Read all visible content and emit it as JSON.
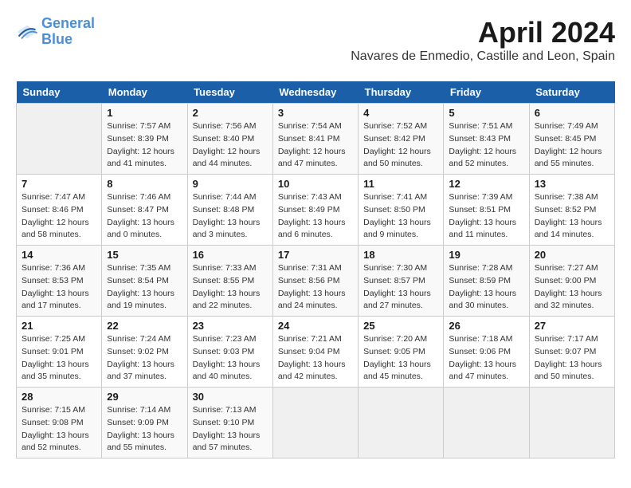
{
  "header": {
    "logo_line1": "General",
    "logo_line2": "Blue",
    "title": "April 2024",
    "subtitle": "Navares de Enmedio, Castille and Leon, Spain"
  },
  "calendar": {
    "days_of_week": [
      "Sunday",
      "Monday",
      "Tuesday",
      "Wednesday",
      "Thursday",
      "Friday",
      "Saturday"
    ],
    "weeks": [
      [
        {
          "day": "",
          "info": ""
        },
        {
          "day": "1",
          "info": "Sunrise: 7:57 AM\nSunset: 8:39 PM\nDaylight: 12 hours\nand 41 minutes."
        },
        {
          "day": "2",
          "info": "Sunrise: 7:56 AM\nSunset: 8:40 PM\nDaylight: 12 hours\nand 44 minutes."
        },
        {
          "day": "3",
          "info": "Sunrise: 7:54 AM\nSunset: 8:41 PM\nDaylight: 12 hours\nand 47 minutes."
        },
        {
          "day": "4",
          "info": "Sunrise: 7:52 AM\nSunset: 8:42 PM\nDaylight: 12 hours\nand 50 minutes."
        },
        {
          "day": "5",
          "info": "Sunrise: 7:51 AM\nSunset: 8:43 PM\nDaylight: 12 hours\nand 52 minutes."
        },
        {
          "day": "6",
          "info": "Sunrise: 7:49 AM\nSunset: 8:45 PM\nDaylight: 12 hours\nand 55 minutes."
        }
      ],
      [
        {
          "day": "7",
          "info": "Sunrise: 7:47 AM\nSunset: 8:46 PM\nDaylight: 12 hours\nand 58 minutes."
        },
        {
          "day": "8",
          "info": "Sunrise: 7:46 AM\nSunset: 8:47 PM\nDaylight: 13 hours\nand 0 minutes."
        },
        {
          "day": "9",
          "info": "Sunrise: 7:44 AM\nSunset: 8:48 PM\nDaylight: 13 hours\nand 3 minutes."
        },
        {
          "day": "10",
          "info": "Sunrise: 7:43 AM\nSunset: 8:49 PM\nDaylight: 13 hours\nand 6 minutes."
        },
        {
          "day": "11",
          "info": "Sunrise: 7:41 AM\nSunset: 8:50 PM\nDaylight: 13 hours\nand 9 minutes."
        },
        {
          "day": "12",
          "info": "Sunrise: 7:39 AM\nSunset: 8:51 PM\nDaylight: 13 hours\nand 11 minutes."
        },
        {
          "day": "13",
          "info": "Sunrise: 7:38 AM\nSunset: 8:52 PM\nDaylight: 13 hours\nand 14 minutes."
        }
      ],
      [
        {
          "day": "14",
          "info": "Sunrise: 7:36 AM\nSunset: 8:53 PM\nDaylight: 13 hours\nand 17 minutes."
        },
        {
          "day": "15",
          "info": "Sunrise: 7:35 AM\nSunset: 8:54 PM\nDaylight: 13 hours\nand 19 minutes."
        },
        {
          "day": "16",
          "info": "Sunrise: 7:33 AM\nSunset: 8:55 PM\nDaylight: 13 hours\nand 22 minutes."
        },
        {
          "day": "17",
          "info": "Sunrise: 7:31 AM\nSunset: 8:56 PM\nDaylight: 13 hours\nand 24 minutes."
        },
        {
          "day": "18",
          "info": "Sunrise: 7:30 AM\nSunset: 8:57 PM\nDaylight: 13 hours\nand 27 minutes."
        },
        {
          "day": "19",
          "info": "Sunrise: 7:28 AM\nSunset: 8:59 PM\nDaylight: 13 hours\nand 30 minutes."
        },
        {
          "day": "20",
          "info": "Sunrise: 7:27 AM\nSunset: 9:00 PM\nDaylight: 13 hours\nand 32 minutes."
        }
      ],
      [
        {
          "day": "21",
          "info": "Sunrise: 7:25 AM\nSunset: 9:01 PM\nDaylight: 13 hours\nand 35 minutes."
        },
        {
          "day": "22",
          "info": "Sunrise: 7:24 AM\nSunset: 9:02 PM\nDaylight: 13 hours\nand 37 minutes."
        },
        {
          "day": "23",
          "info": "Sunrise: 7:23 AM\nSunset: 9:03 PM\nDaylight: 13 hours\nand 40 minutes."
        },
        {
          "day": "24",
          "info": "Sunrise: 7:21 AM\nSunset: 9:04 PM\nDaylight: 13 hours\nand 42 minutes."
        },
        {
          "day": "25",
          "info": "Sunrise: 7:20 AM\nSunset: 9:05 PM\nDaylight: 13 hours\nand 45 minutes."
        },
        {
          "day": "26",
          "info": "Sunrise: 7:18 AM\nSunset: 9:06 PM\nDaylight: 13 hours\nand 47 minutes."
        },
        {
          "day": "27",
          "info": "Sunrise: 7:17 AM\nSunset: 9:07 PM\nDaylight: 13 hours\nand 50 minutes."
        }
      ],
      [
        {
          "day": "28",
          "info": "Sunrise: 7:15 AM\nSunset: 9:08 PM\nDaylight: 13 hours\nand 52 minutes."
        },
        {
          "day": "29",
          "info": "Sunrise: 7:14 AM\nSunset: 9:09 PM\nDaylight: 13 hours\nand 55 minutes."
        },
        {
          "day": "30",
          "info": "Sunrise: 7:13 AM\nSunset: 9:10 PM\nDaylight: 13 hours\nand 57 minutes."
        },
        {
          "day": "",
          "info": ""
        },
        {
          "day": "",
          "info": ""
        },
        {
          "day": "",
          "info": ""
        },
        {
          "day": "",
          "info": ""
        }
      ]
    ]
  }
}
